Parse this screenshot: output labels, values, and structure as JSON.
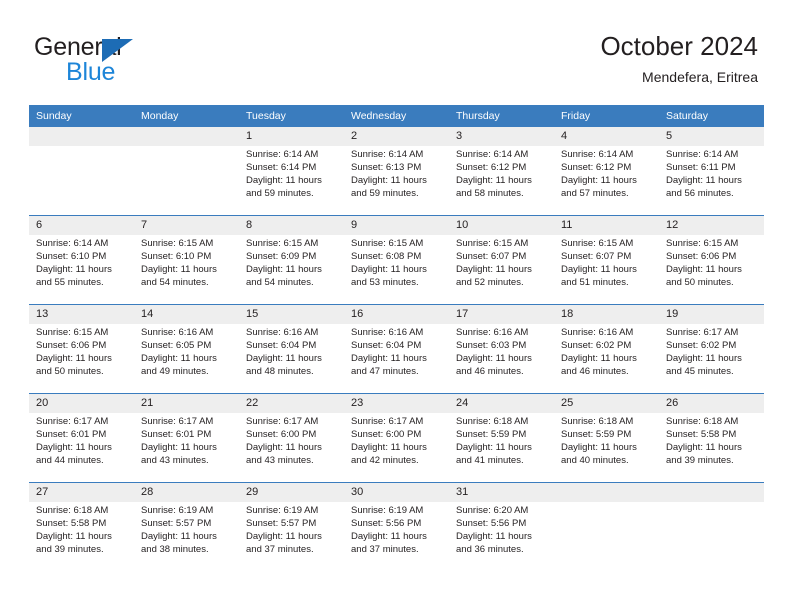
{
  "brand": {
    "word1": "General",
    "word2": "Blue",
    "triangle_color": "#1d6cb5",
    "blue_color": "#1d85d8"
  },
  "header": {
    "title": "October 2024",
    "location": "Mendefera, Eritrea"
  },
  "calendar": {
    "header_bg": "#3a7cbe",
    "daterow_bg": "#eeeeee",
    "weekdays": [
      "Sunday",
      "Monday",
      "Tuesday",
      "Wednesday",
      "Thursday",
      "Friday",
      "Saturday"
    ],
    "weeks": [
      [
        {
          "day": "",
          "sunrise": "",
          "sunset": "",
          "daylight1": "",
          "daylight2": ""
        },
        {
          "day": "",
          "sunrise": "",
          "sunset": "",
          "daylight1": "",
          "daylight2": ""
        },
        {
          "day": "1",
          "sunrise": "Sunrise: 6:14 AM",
          "sunset": "Sunset: 6:14 PM",
          "daylight1": "Daylight: 11 hours",
          "daylight2": "and 59 minutes."
        },
        {
          "day": "2",
          "sunrise": "Sunrise: 6:14 AM",
          "sunset": "Sunset: 6:13 PM",
          "daylight1": "Daylight: 11 hours",
          "daylight2": "and 59 minutes."
        },
        {
          "day": "3",
          "sunrise": "Sunrise: 6:14 AM",
          "sunset": "Sunset: 6:12 PM",
          "daylight1": "Daylight: 11 hours",
          "daylight2": "and 58 minutes."
        },
        {
          "day": "4",
          "sunrise": "Sunrise: 6:14 AM",
          "sunset": "Sunset: 6:12 PM",
          "daylight1": "Daylight: 11 hours",
          "daylight2": "and 57 minutes."
        },
        {
          "day": "5",
          "sunrise": "Sunrise: 6:14 AM",
          "sunset": "Sunset: 6:11 PM",
          "daylight1": "Daylight: 11 hours",
          "daylight2": "and 56 minutes."
        }
      ],
      [
        {
          "day": "6",
          "sunrise": "Sunrise: 6:14 AM",
          "sunset": "Sunset: 6:10 PM",
          "daylight1": "Daylight: 11 hours",
          "daylight2": "and 55 minutes."
        },
        {
          "day": "7",
          "sunrise": "Sunrise: 6:15 AM",
          "sunset": "Sunset: 6:10 PM",
          "daylight1": "Daylight: 11 hours",
          "daylight2": "and 54 minutes."
        },
        {
          "day": "8",
          "sunrise": "Sunrise: 6:15 AM",
          "sunset": "Sunset: 6:09 PM",
          "daylight1": "Daylight: 11 hours",
          "daylight2": "and 54 minutes."
        },
        {
          "day": "9",
          "sunrise": "Sunrise: 6:15 AM",
          "sunset": "Sunset: 6:08 PM",
          "daylight1": "Daylight: 11 hours",
          "daylight2": "and 53 minutes."
        },
        {
          "day": "10",
          "sunrise": "Sunrise: 6:15 AM",
          "sunset": "Sunset: 6:07 PM",
          "daylight1": "Daylight: 11 hours",
          "daylight2": "and 52 minutes."
        },
        {
          "day": "11",
          "sunrise": "Sunrise: 6:15 AM",
          "sunset": "Sunset: 6:07 PM",
          "daylight1": "Daylight: 11 hours",
          "daylight2": "and 51 minutes."
        },
        {
          "day": "12",
          "sunrise": "Sunrise: 6:15 AM",
          "sunset": "Sunset: 6:06 PM",
          "daylight1": "Daylight: 11 hours",
          "daylight2": "and 50 minutes."
        }
      ],
      [
        {
          "day": "13",
          "sunrise": "Sunrise: 6:15 AM",
          "sunset": "Sunset: 6:06 PM",
          "daylight1": "Daylight: 11 hours",
          "daylight2": "and 50 minutes."
        },
        {
          "day": "14",
          "sunrise": "Sunrise: 6:16 AM",
          "sunset": "Sunset: 6:05 PM",
          "daylight1": "Daylight: 11 hours",
          "daylight2": "and 49 minutes."
        },
        {
          "day": "15",
          "sunrise": "Sunrise: 6:16 AM",
          "sunset": "Sunset: 6:04 PM",
          "daylight1": "Daylight: 11 hours",
          "daylight2": "and 48 minutes."
        },
        {
          "day": "16",
          "sunrise": "Sunrise: 6:16 AM",
          "sunset": "Sunset: 6:04 PM",
          "daylight1": "Daylight: 11 hours",
          "daylight2": "and 47 minutes."
        },
        {
          "day": "17",
          "sunrise": "Sunrise: 6:16 AM",
          "sunset": "Sunset: 6:03 PM",
          "daylight1": "Daylight: 11 hours",
          "daylight2": "and 46 minutes."
        },
        {
          "day": "18",
          "sunrise": "Sunrise: 6:16 AM",
          "sunset": "Sunset: 6:02 PM",
          "daylight1": "Daylight: 11 hours",
          "daylight2": "and 46 minutes."
        },
        {
          "day": "19",
          "sunrise": "Sunrise: 6:17 AM",
          "sunset": "Sunset: 6:02 PM",
          "daylight1": "Daylight: 11 hours",
          "daylight2": "and 45 minutes."
        }
      ],
      [
        {
          "day": "20",
          "sunrise": "Sunrise: 6:17 AM",
          "sunset": "Sunset: 6:01 PM",
          "daylight1": "Daylight: 11 hours",
          "daylight2": "and 44 minutes."
        },
        {
          "day": "21",
          "sunrise": "Sunrise: 6:17 AM",
          "sunset": "Sunset: 6:01 PM",
          "daylight1": "Daylight: 11 hours",
          "daylight2": "and 43 minutes."
        },
        {
          "day": "22",
          "sunrise": "Sunrise: 6:17 AM",
          "sunset": "Sunset: 6:00 PM",
          "daylight1": "Daylight: 11 hours",
          "daylight2": "and 43 minutes."
        },
        {
          "day": "23",
          "sunrise": "Sunrise: 6:17 AM",
          "sunset": "Sunset: 6:00 PM",
          "daylight1": "Daylight: 11 hours",
          "daylight2": "and 42 minutes."
        },
        {
          "day": "24",
          "sunrise": "Sunrise: 6:18 AM",
          "sunset": "Sunset: 5:59 PM",
          "daylight1": "Daylight: 11 hours",
          "daylight2": "and 41 minutes."
        },
        {
          "day": "25",
          "sunrise": "Sunrise: 6:18 AM",
          "sunset": "Sunset: 5:59 PM",
          "daylight1": "Daylight: 11 hours",
          "daylight2": "and 40 minutes."
        },
        {
          "day": "26",
          "sunrise": "Sunrise: 6:18 AM",
          "sunset": "Sunset: 5:58 PM",
          "daylight1": "Daylight: 11 hours",
          "daylight2": "and 39 minutes."
        }
      ],
      [
        {
          "day": "27",
          "sunrise": "Sunrise: 6:18 AM",
          "sunset": "Sunset: 5:58 PM",
          "daylight1": "Daylight: 11 hours",
          "daylight2": "and 39 minutes."
        },
        {
          "day": "28",
          "sunrise": "Sunrise: 6:19 AM",
          "sunset": "Sunset: 5:57 PM",
          "daylight1": "Daylight: 11 hours",
          "daylight2": "and 38 minutes."
        },
        {
          "day": "29",
          "sunrise": "Sunrise: 6:19 AM",
          "sunset": "Sunset: 5:57 PM",
          "daylight1": "Daylight: 11 hours",
          "daylight2": "and 37 minutes."
        },
        {
          "day": "30",
          "sunrise": "Sunrise: 6:19 AM",
          "sunset": "Sunset: 5:56 PM",
          "daylight1": "Daylight: 11 hours",
          "daylight2": "and 37 minutes."
        },
        {
          "day": "31",
          "sunrise": "Sunrise: 6:20 AM",
          "sunset": "Sunset: 5:56 PM",
          "daylight1": "Daylight: 11 hours",
          "daylight2": "and 36 minutes."
        },
        {
          "day": "",
          "sunrise": "",
          "sunset": "",
          "daylight1": "",
          "daylight2": ""
        },
        {
          "day": "",
          "sunrise": "",
          "sunset": "",
          "daylight1": "",
          "daylight2": ""
        }
      ]
    ]
  }
}
